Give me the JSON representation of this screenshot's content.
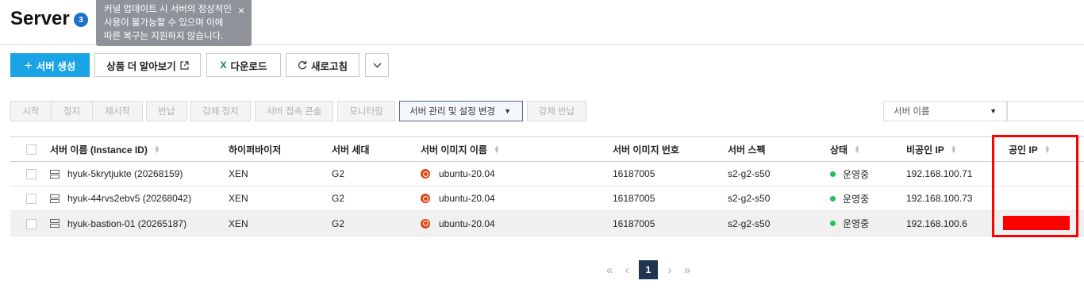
{
  "header": {
    "title": "Server",
    "count": "3",
    "notice": "커널 업데이트 시 서버의 정상적인 사용이 불가능할 수 있으며 이에 따른 복구는 지원하지 않습니다.",
    "notice_close": "×"
  },
  "toolbar": {
    "create": "서버 생성",
    "learn_more": "상품 더 알아보기",
    "download": "다운로드",
    "refresh": "새로고침"
  },
  "actions": {
    "start": "시작",
    "stop": "정지",
    "restart": "재시작",
    "return": "반납",
    "force_stop": "강제 정지",
    "console": "서버 접속 콘솔",
    "monitoring": "모니터링",
    "manage": "서버 관리 및 설정 변경",
    "force_return": "강제 반납"
  },
  "search": {
    "field": "서버 이름"
  },
  "table": {
    "columns": [
      "서버 이름 (Instance ID)",
      "하이퍼바이저",
      "서버 세대",
      "서버 이미지 이름",
      "서버 이미지 번호",
      "서버 스펙",
      "상태",
      "비공인 IP",
      "공인 IP"
    ],
    "rows": [
      [
        "hyuk-5krytjukte (20268159)",
        "XEN",
        "G2",
        "ubuntu-20.04",
        "16187005",
        "s2-g2-s50",
        "운영중",
        "192.168.100.71",
        ""
      ],
      [
        "hyuk-44rvs2ebv5 (20268042)",
        "XEN",
        "G2",
        "ubuntu-20.04",
        "16187005",
        "s2-g2-s50",
        "운영중",
        "192.168.100.73",
        ""
      ],
      [
        "hyuk-bastion-01 (20265187)",
        "XEN",
        "G2",
        "ubuntu-20.04",
        "16187005",
        "s2-g2-s50",
        "운영중",
        "192.168.100.6",
        ""
      ]
    ]
  },
  "pager": {
    "first": "«",
    "prev": "‹",
    "current": "1",
    "next": "›",
    "last": "»"
  },
  "colors": {
    "primary": "#1aa4e6",
    "badge": "#1a73c9",
    "status_running": "#1ec05c",
    "highlight": "#ff0000",
    "excel": "#1d7a45"
  }
}
